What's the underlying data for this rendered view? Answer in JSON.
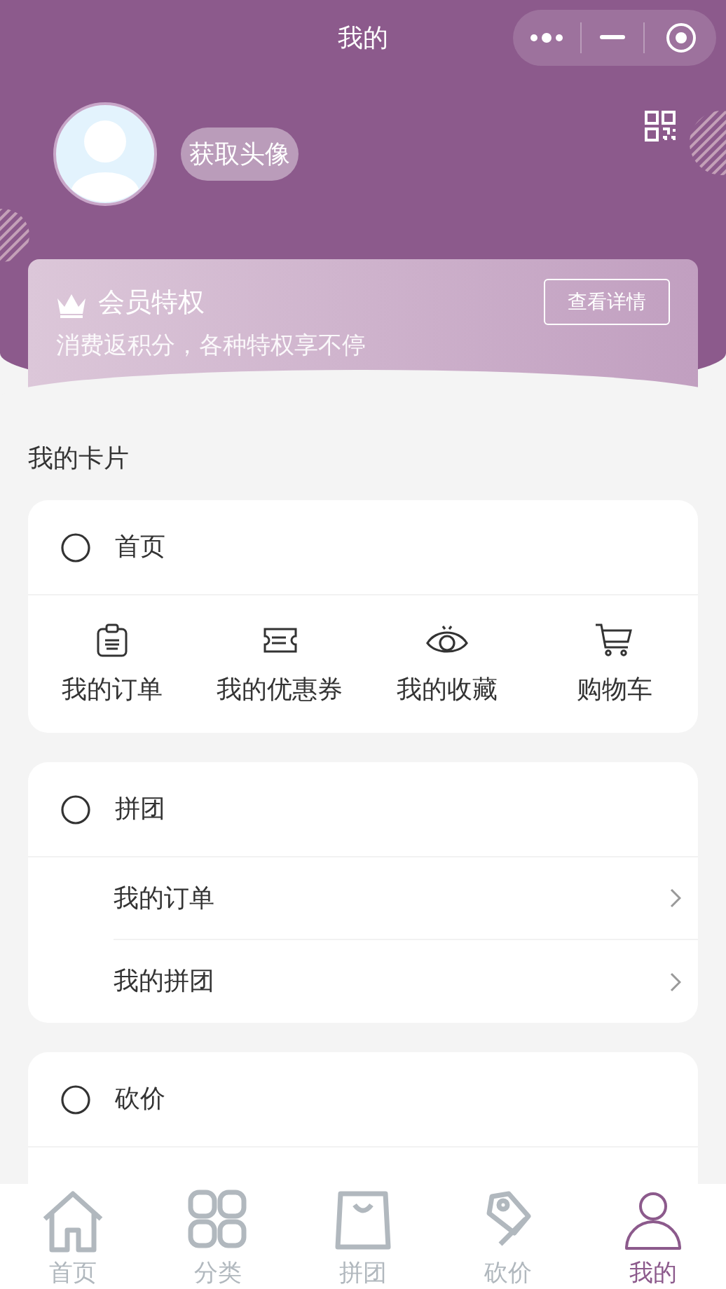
{
  "nav_bar": {
    "title": "我的"
  },
  "profile": {
    "avatar_button": "获取头像"
  },
  "member_card": {
    "title": "会员特权",
    "subtitle": "消费返积分，各种特权享不停",
    "button": "查看详情"
  },
  "section_title": "我的卡片",
  "cards": [
    {
      "title": "首页",
      "kind": "grid",
      "items": [
        {
          "label": "我的订单"
        },
        {
          "label": "我的优惠券"
        },
        {
          "label": "我的收藏"
        },
        {
          "label": "购物车"
        }
      ]
    },
    {
      "title": "拼团",
      "kind": "list",
      "items": [
        {
          "label": "我的订单"
        },
        {
          "label": "我的拼团"
        }
      ]
    },
    {
      "title": "砍价",
      "kind": "list"
    }
  ],
  "tab_bar": [
    {
      "label": "首页",
      "selected": false
    },
    {
      "label": "分类",
      "selected": false
    },
    {
      "label": "拼团",
      "selected": false
    },
    {
      "label": "砍价",
      "selected": false
    },
    {
      "label": "我的",
      "selected": true
    }
  ]
}
